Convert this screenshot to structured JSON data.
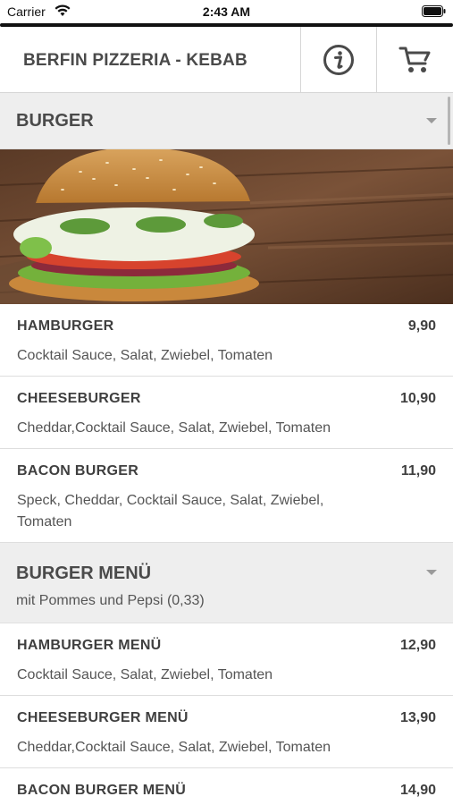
{
  "status_bar": {
    "carrier": "Carrier",
    "time": "2:43 AM"
  },
  "header": {
    "title": "BERFIN PIZZERIA - KEBAB",
    "info_icon": "info-circle-icon",
    "cart_icon": "shopping-cart-icon"
  },
  "categories": [
    {
      "title": "BURGER",
      "subtitle": "",
      "items": [
        {
          "name": "HAMBURGER",
          "price": "9,90",
          "description": "Cocktail Sauce, Salat, Zwiebel, Tomaten"
        },
        {
          "name": "CHEESEBURGER",
          "price": "10,90",
          "description": "Cheddar,Cocktail Sauce, Salat, Zwiebel, Tomaten"
        },
        {
          "name": "BACON BURGER",
          "price": "11,90",
          "description": "Speck, Cheddar, Cocktail Sauce, Salat, Zwiebel, Tomaten"
        }
      ]
    },
    {
      "title": "BURGER MENÜ",
      "subtitle": "mit Pommes und Pepsi (0,33)",
      "items": [
        {
          "name": "HAMBURGER MENÜ",
          "price": "12,90",
          "description": "Cocktail Sauce, Salat, Zwiebel, Tomaten"
        },
        {
          "name": "CHEESEBURGER MENÜ",
          "price": "13,90",
          "description": "Cheddar,Cocktail Sauce, Salat, Zwiebel, Tomaten"
        },
        {
          "name": "BACON BURGER MENÜ",
          "price": "14,90",
          "description": ""
        }
      ]
    }
  ],
  "colors": {
    "text": "#3f3f3f",
    "category_bg": "#eeeeee",
    "divider": "#dedede"
  }
}
